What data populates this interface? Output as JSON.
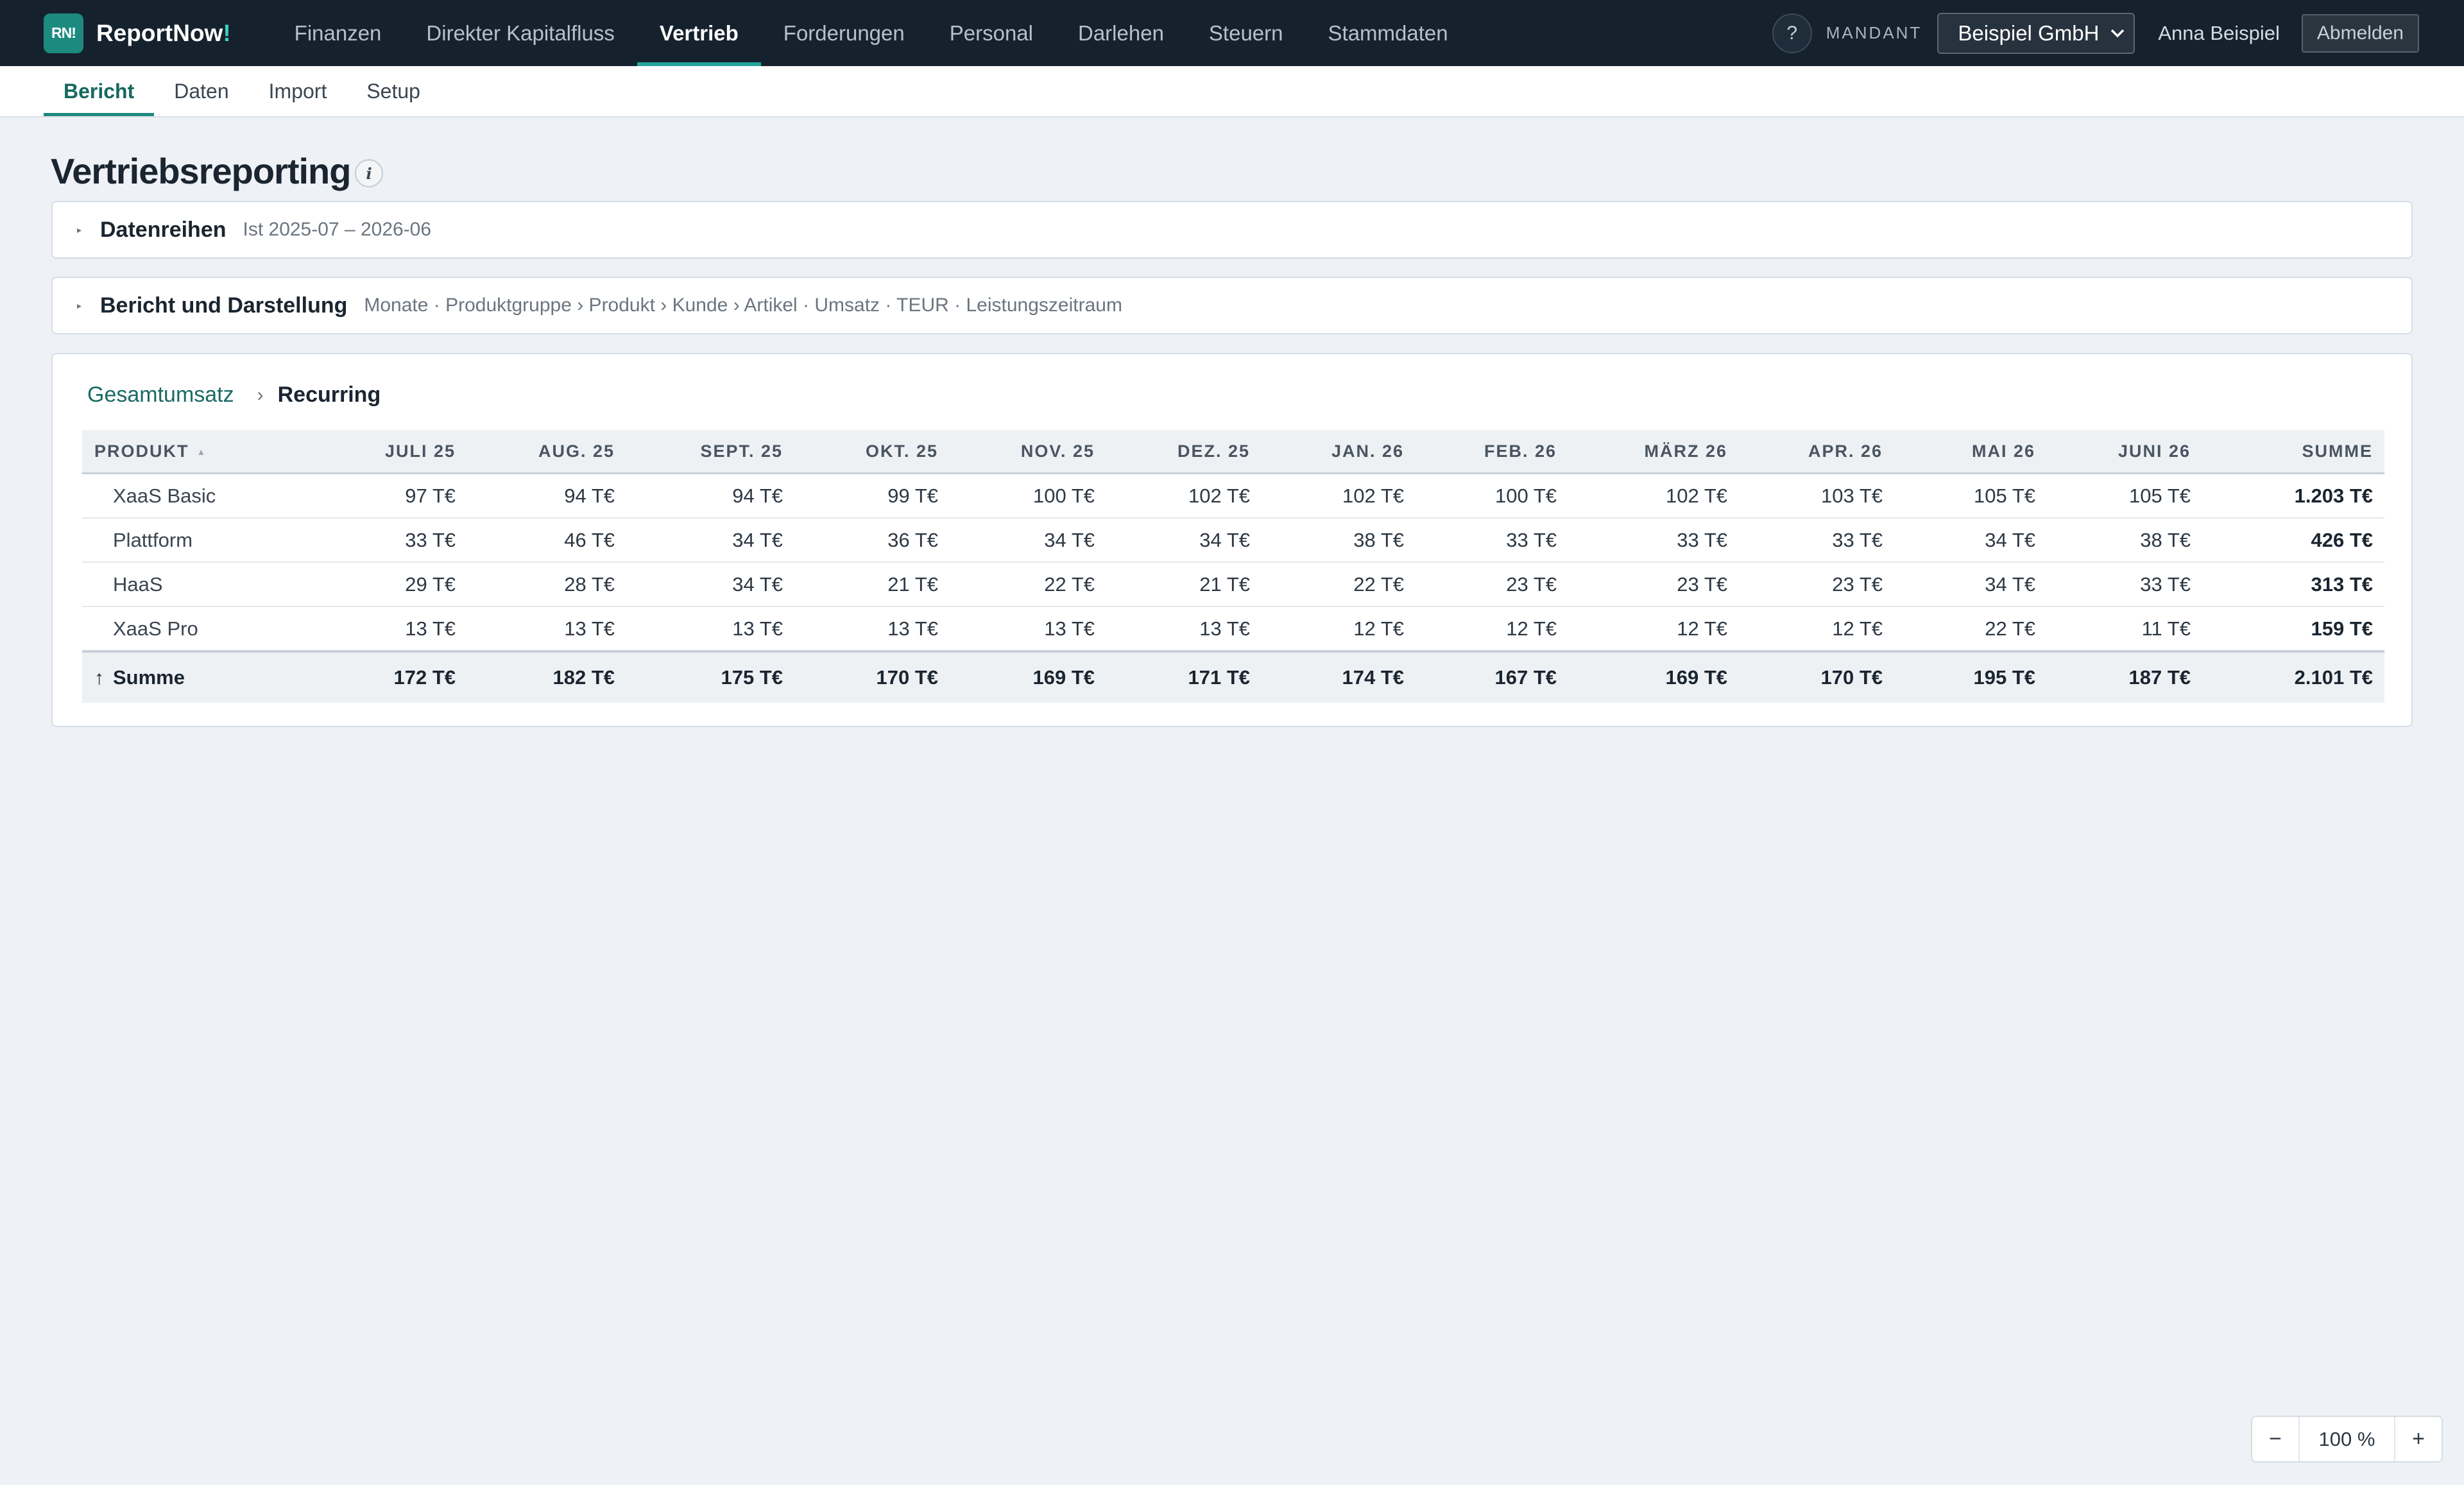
{
  "app": {
    "logo_badge": "RN!",
    "logo_name": "ReportNow",
    "logo_excl": "!"
  },
  "nav": {
    "items": [
      "Finanzen",
      "Direkter Kapitalfluss",
      "Vertrieb",
      "Forderungen",
      "Personal",
      "Darlehen",
      "Steuern",
      "Stammdaten"
    ],
    "active": "Vertrieb"
  },
  "header": {
    "help": "?",
    "mandant_label": "MANDANT",
    "mandant_value": "Beispiel GmbH",
    "user": "Anna Beispiel",
    "logout": "Abmelden"
  },
  "subnav": {
    "items": [
      "Bericht",
      "Daten",
      "Import",
      "Setup"
    ],
    "active": "Bericht"
  },
  "page": {
    "title": "Vertriebsreporting",
    "info_icon": "i"
  },
  "panels": {
    "datenreihen": {
      "title": "Datenreihen",
      "subtitle": "Ist 2025-07 – 2026-06"
    },
    "bericht": {
      "title": "Bericht und Darstellung",
      "subtitle": "Monate · Produktgruppe › Produkt › Kunde › Artikel · Umsatz · TEUR · Leistungszeitraum"
    }
  },
  "breadcrumb": {
    "root": "Gesamtumsatz",
    "separator": "›",
    "current": "Recurring"
  },
  "table": {
    "headers": [
      "PRODUKT",
      "JULI 25",
      "AUG. 25",
      "SEPT. 25",
      "OKT. 25",
      "NOV. 25",
      "DEZ. 25",
      "JAN. 26",
      "FEB. 26",
      "MÄRZ 26",
      "APR. 26",
      "MAI 26",
      "JUNI 26",
      "SUMME"
    ],
    "rows": [
      {
        "name": "XaaS Basic",
        "values": [
          "97 T€",
          "94 T€",
          "94 T€",
          "99 T€",
          "100 T€",
          "102 T€",
          "102 T€",
          "100 T€",
          "102 T€",
          "103 T€",
          "105 T€",
          "105 T€"
        ],
        "sum": "1.203 T€"
      },
      {
        "name": "Plattform",
        "values": [
          "33 T€",
          "46 T€",
          "34 T€",
          "36 T€",
          "34 T€",
          "34 T€",
          "38 T€",
          "33 T€",
          "33 T€",
          "33 T€",
          "34 T€",
          "38 T€"
        ],
        "sum": "426 T€"
      },
      {
        "name": "HaaS",
        "values": [
          "29 T€",
          "28 T€",
          "34 T€",
          "21 T€",
          "22 T€",
          "21 T€",
          "22 T€",
          "23 T€",
          "23 T€",
          "23 T€",
          "34 T€",
          "33 T€"
        ],
        "sum": "313 T€"
      },
      {
        "name": "XaaS Pro",
        "values": [
          "13 T€",
          "13 T€",
          "13 T€",
          "13 T€",
          "13 T€",
          "13 T€",
          "12 T€",
          "12 T€",
          "12 T€",
          "12 T€",
          "22 T€",
          "11 T€"
        ],
        "sum": "159 T€"
      }
    ],
    "total": {
      "name": "Summe",
      "values": [
        "172 T€",
        "182 T€",
        "175 T€",
        "170 T€",
        "169 T€",
        "171 T€",
        "174 T€",
        "167 T€",
        "169 T€",
        "170 T€",
        "195 T€",
        "187 T€"
      ],
      "sum": "2.101 T€"
    }
  },
  "zoom": {
    "minus": "−",
    "value": "100 %",
    "plus": "+"
  }
}
